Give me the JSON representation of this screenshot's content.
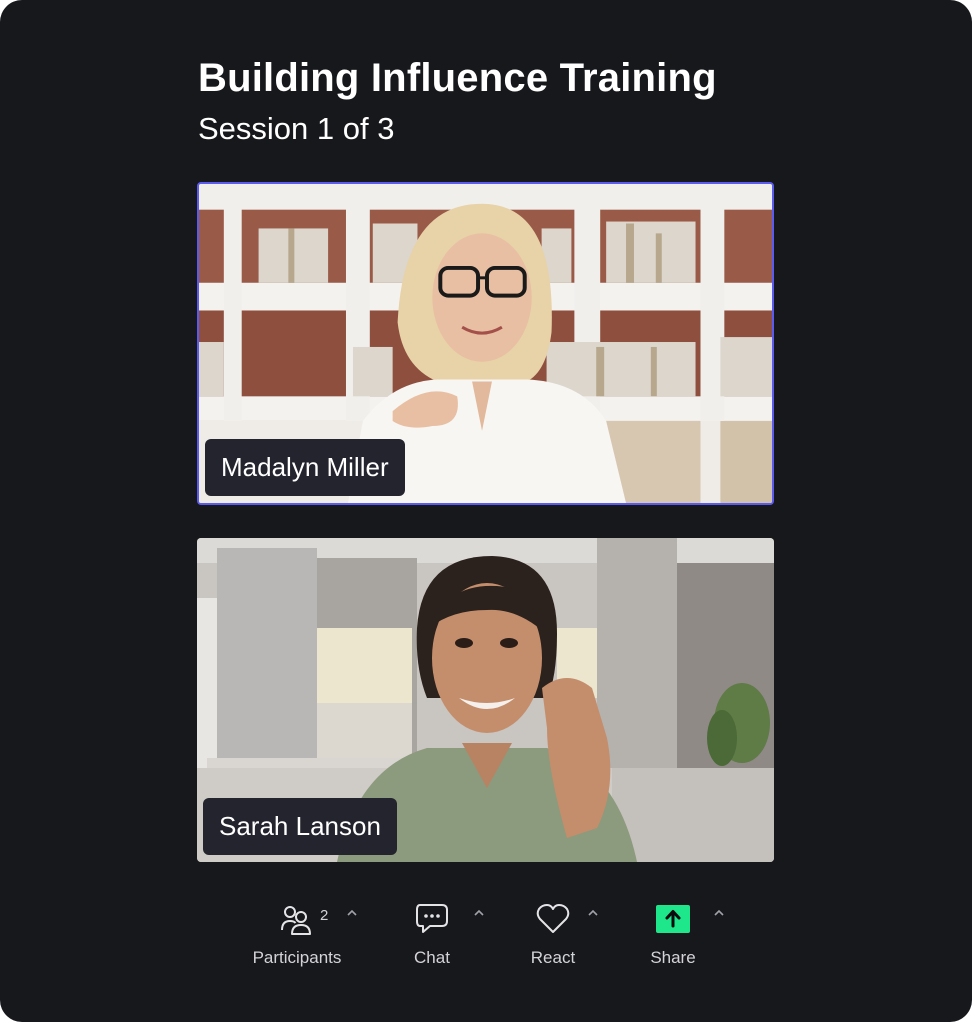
{
  "meeting": {
    "title": "Building Influence Training",
    "subtitle": "Session 1 of 3"
  },
  "participants": [
    {
      "name": "Madalyn Miller",
      "active_speaker": true
    },
    {
      "name": "Sarah Lanson",
      "active_speaker": false
    }
  ],
  "toolbar": {
    "participants": {
      "label": "Participants",
      "count": "2",
      "icon": "participants-icon"
    },
    "chat": {
      "label": "Chat",
      "icon": "chat-icon"
    },
    "react": {
      "label": "React",
      "icon": "heart-icon"
    },
    "share": {
      "label": "Share",
      "icon": "share-upload-icon"
    }
  },
  "colors": {
    "background": "#17181c",
    "active_speaker_border": "#5b5bf0",
    "name_tag": "#23242e",
    "share_accent": "#1ee68a",
    "toolbar_text": "#d4d4d8"
  }
}
